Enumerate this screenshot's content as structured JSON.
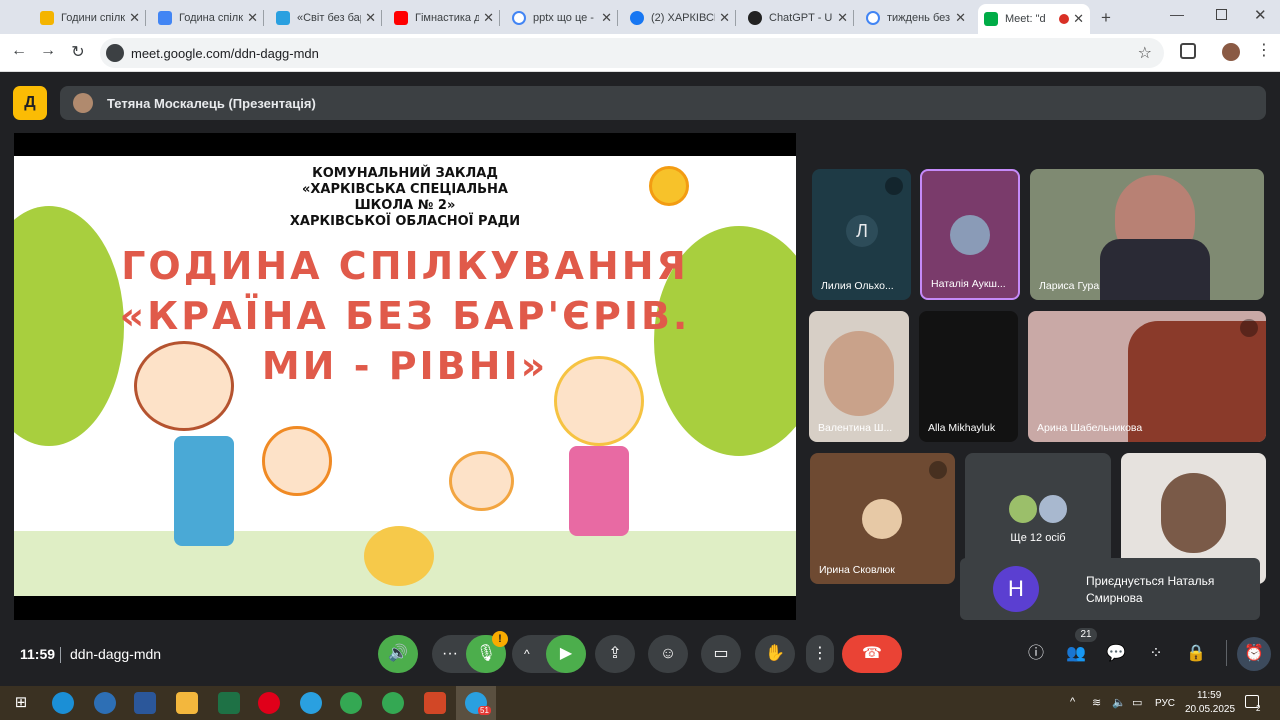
{
  "browser": {
    "tabs": [
      {
        "label": "Години спілк",
        "color": "#f4b400"
      },
      {
        "label": "Година спілк",
        "color": "#4285f4"
      },
      {
        "label": "«Світ без бар",
        "color": "#2aa0e0"
      },
      {
        "label": "Гімнастика д",
        "color": "#ff0000"
      },
      {
        "label": "pptx що це -",
        "color": "#e8eaed"
      },
      {
        "label": "(2) ХАРКІВСЬ",
        "color": "#1877f2"
      },
      {
        "label": "ChatGPT - Uk",
        "color": "#222222"
      },
      {
        "label": "тиждень без",
        "color": "#e8eaed"
      },
      {
        "label": "Meet: \"d",
        "color": "#00ac47"
      }
    ],
    "url": "meet.google.com/ddn-dagg-mdn"
  },
  "meet": {
    "presenter": "Тетяна Москалець (Презентація)",
    "slide": {
      "line1": "КОМУНАЛЬНИЙ ЗАКЛАД",
      "line2": "«ХАРКІВСЬКА СПЕЦІАЛЬНА",
      "line3": "ШКОЛА № 2»",
      "line4": "ХАРКІВСЬКОЇ ОБЛАСНОЇ РАДИ",
      "title1": "ГОДИНА СПІЛКУВАННЯ",
      "title2": "«КРАЇНА БЕЗ БАР'ЄРІВ.",
      "title3": "МИ - РІВНІ»"
    },
    "participants": [
      {
        "name": "Лилия Ольхо...",
        "initial": "Л"
      },
      {
        "name": "Наталія Аукш..."
      },
      {
        "name": "Лариса Гура"
      },
      {
        "name": "Валентина Ш..."
      },
      {
        "name": "Alla Mikhayluk"
      },
      {
        "name": "Арина Шабельникова"
      },
      {
        "name": "Ирина Сковлюк"
      },
      {
        "name": "Ще 12 осіб"
      },
      {
        "name": ""
      }
    ],
    "toast": {
      "initial": "Н",
      "text": "Приєднується Наталья Смирнова"
    },
    "time": "11:59",
    "code": "ddn-dagg-mdn",
    "people_count": "21",
    "colors": {
      "mic_on": "#4cae4c",
      "end_call": "#ea4335",
      "toast_avatar": "#5b3fd1"
    }
  },
  "taskbar": {
    "lang": "РУС",
    "time": "11:59",
    "date": "20.05.2025",
    "telegram_badge": "51",
    "notif_count": "2"
  }
}
